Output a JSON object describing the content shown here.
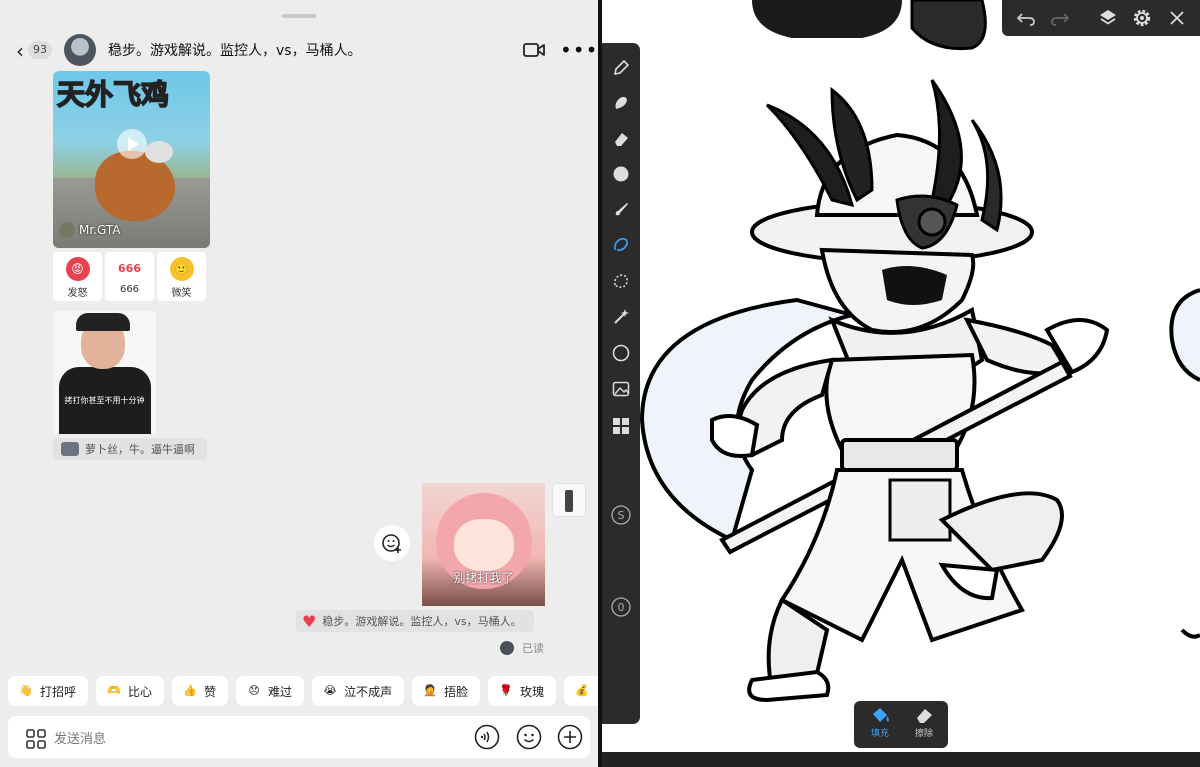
{
  "chat": {
    "unread_count": "93",
    "title": "稳步。游戏解说。监控人，vs，马桶人。",
    "video_card": {
      "caption": "天外飞鸡",
      "channel": "Mr.GTA"
    },
    "reactions": [
      {
        "label": "发怒",
        "face": "😡",
        "color": "#e8424f"
      },
      {
        "label": "666",
        "face": "666",
        "color": "#ffffff"
      },
      {
        "label": "微笑",
        "face": "🙂",
        "color": "#f6c22c"
      }
    ],
    "photo_overlay": "拷打你甚至不用十分钟",
    "quote_text": "萝卜丝，牛。逼牛逼啊",
    "sticker_text": "别拷打我了",
    "liked_quote": "稳步。游戏解说。监控人，vs，马桶人。",
    "read_status": "已读",
    "quick_replies": [
      {
        "label": "打招呼",
        "emoji": "👋",
        "color": "#ffb347"
      },
      {
        "label": "比心",
        "emoji": "🫶",
        "color": "#ffcc66"
      },
      {
        "label": "赞",
        "emoji": "👍",
        "color": "#ffcc33"
      },
      {
        "label": "难过",
        "emoji": "😞",
        "color": "#ffcc33"
      },
      {
        "label": "泣不成声",
        "emoji": "😭",
        "color": "#ffcc33"
      },
      {
        "label": "捂脸",
        "emoji": "🤦",
        "color": "#ffcc33"
      },
      {
        "label": "玫瑰",
        "emoji": "🌹",
        "color": "#e8424f"
      },
      {
        "label": "",
        "emoji": "💰",
        "color": "#ffcc33"
      }
    ],
    "input_placeholder": "发送消息"
  },
  "drawing": {
    "fill_label": "填充",
    "erase_label": "擦除",
    "side_badges": [
      "S",
      "0"
    ],
    "accent": "#3aa3ff"
  }
}
